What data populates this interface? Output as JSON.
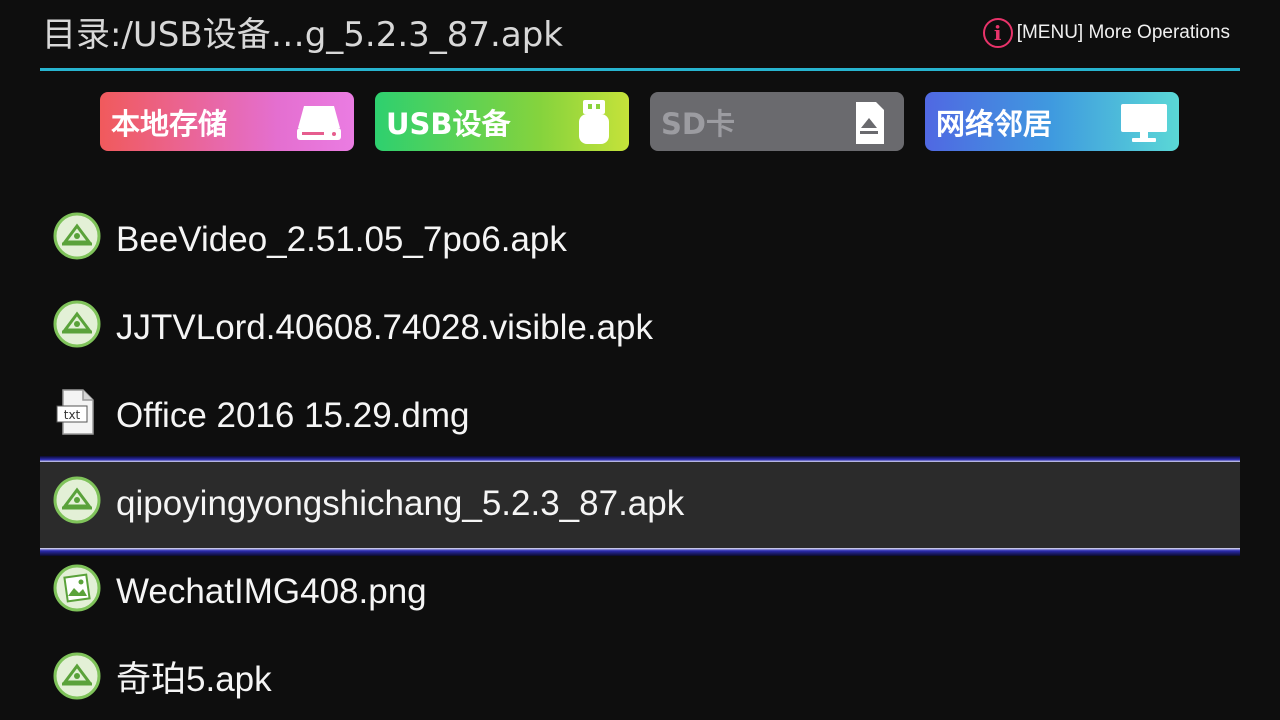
{
  "header": {
    "path": "目录:/USB设备…g_5.2.3_87.apk",
    "menu_hint": "[MENU] More Operations",
    "info_glyph": "i"
  },
  "tabs": [
    {
      "label": "本地存储",
      "icon": "hard-drive-icon",
      "enabled": true
    },
    {
      "label": "USB设备",
      "icon": "usb-drive-icon",
      "enabled": true
    },
    {
      "label": "SD卡",
      "icon": "sd-card-icon",
      "enabled": false
    },
    {
      "label": "网络邻居",
      "icon": "monitor-icon",
      "enabled": true
    }
  ],
  "files": [
    {
      "name": "BeeVideo_2.51.05_7po6.apk",
      "icon": "apk-icon",
      "selected": false
    },
    {
      "name": "JJTVLord.40608.74028.visible.apk",
      "icon": "apk-icon",
      "selected": false
    },
    {
      "name": "Office 2016 15.29.dmg",
      "icon": "txt-file-icon",
      "icon_text": "txt",
      "selected": false
    },
    {
      "name": "qipoyingyongshichang_5.2.3_87.apk",
      "icon": "apk-icon",
      "selected": true
    },
    {
      "name": "WechatIMG408.png",
      "icon": "image-file-icon",
      "selected": false
    },
    {
      "name": "奇珀5.apk",
      "icon": "apk-icon",
      "selected": false
    }
  ],
  "colors": {
    "header_line": "#27b4cf",
    "info_icon": "#e8336a",
    "selection_bg": "#2b2b2b",
    "apk_icon_green": "#7fc35a"
  }
}
